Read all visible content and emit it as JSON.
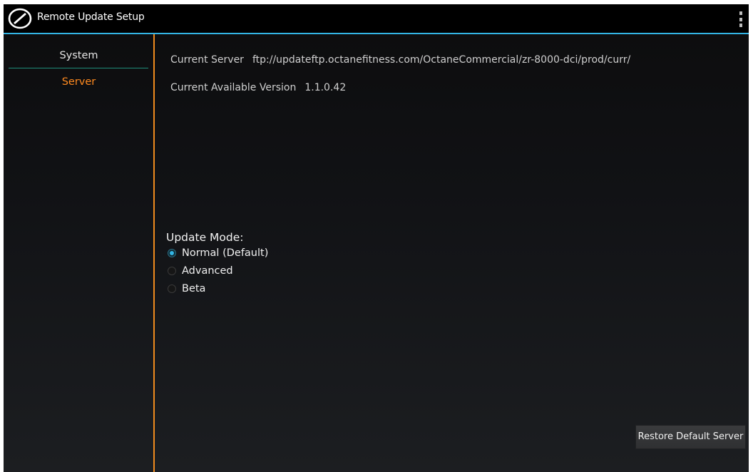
{
  "header": {
    "title": "Remote Update Setup",
    "logo_icon": "octane-logo-icon",
    "menu_icon": "overflow-menu-icon",
    "accent_color": "#33b5e5"
  },
  "sidebar": {
    "items": [
      {
        "label": "System",
        "selected": false
      },
      {
        "label": "Server",
        "selected": true
      }
    ],
    "selected_color": "#ff8a1f"
  },
  "server": {
    "current_server_label": "Current Server",
    "current_server_value": "ftp://updateftp.octanefitness.com/OctaneCommercial/zr-8000-dci/prod/curr/",
    "available_version_label": "Current Available Version",
    "available_version_value": "1.1.0.42"
  },
  "update_mode": {
    "title": "Update Mode:",
    "options": [
      {
        "label": "Normal (Default)",
        "checked": true
      },
      {
        "label": "Advanced",
        "checked": false
      },
      {
        "label": "Beta",
        "checked": false
      }
    ]
  },
  "actions": {
    "restore_label": "Restore Default Server"
  }
}
